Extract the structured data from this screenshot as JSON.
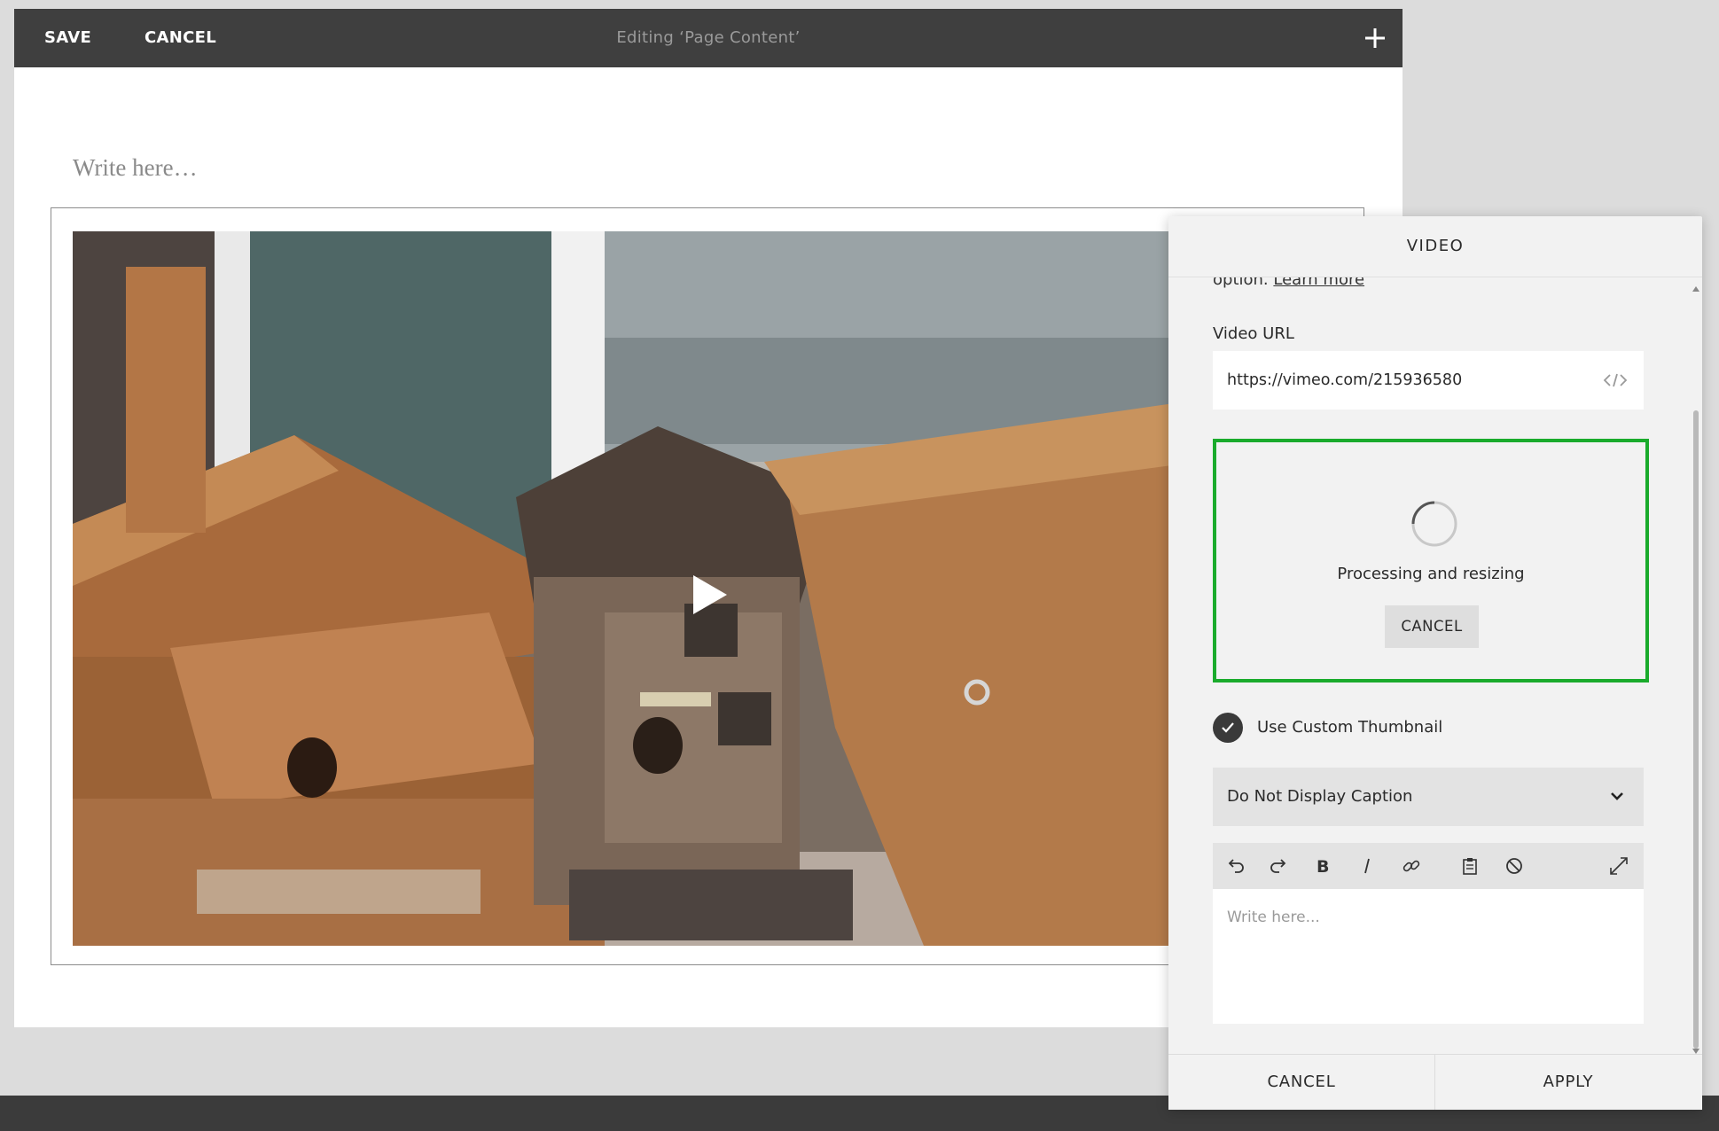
{
  "topbar": {
    "save_label": "SAVE",
    "cancel_label": "CANCEL",
    "title": "Editing ‘Page Content’",
    "add_icon": "plus-icon"
  },
  "canvas": {
    "placeholder": "Write here…"
  },
  "video_block": {
    "play_icon": "play-icon"
  },
  "panel": {
    "title": "VIDEO",
    "truncated_text": "option.",
    "learn_more": "Learn more",
    "video_url_label": "Video URL",
    "video_url_value": "https://vimeo.com/215936580",
    "embed_icon": "code-icon",
    "processing_text": "Processing and resizing",
    "processing_cancel": "CANCEL",
    "custom_thumbnail_label": "Use Custom Thumbnail",
    "custom_thumbnail_checked": true,
    "caption_select_value": "Do Not Display Caption",
    "editor_toolbar": [
      "undo-icon",
      "redo-icon",
      "bold-icon",
      "italic-icon",
      "link-icon",
      "paste-icon",
      "clear-format-icon",
      "expand-icon"
    ],
    "editor_placeholder": "Write here...",
    "footer_cancel": "CANCEL",
    "footer_apply": "APPLY"
  },
  "colors": {
    "topbar": "#3f3f3f",
    "processing_border": "#1aab2c",
    "panel_bg": "#f2f2f2"
  }
}
